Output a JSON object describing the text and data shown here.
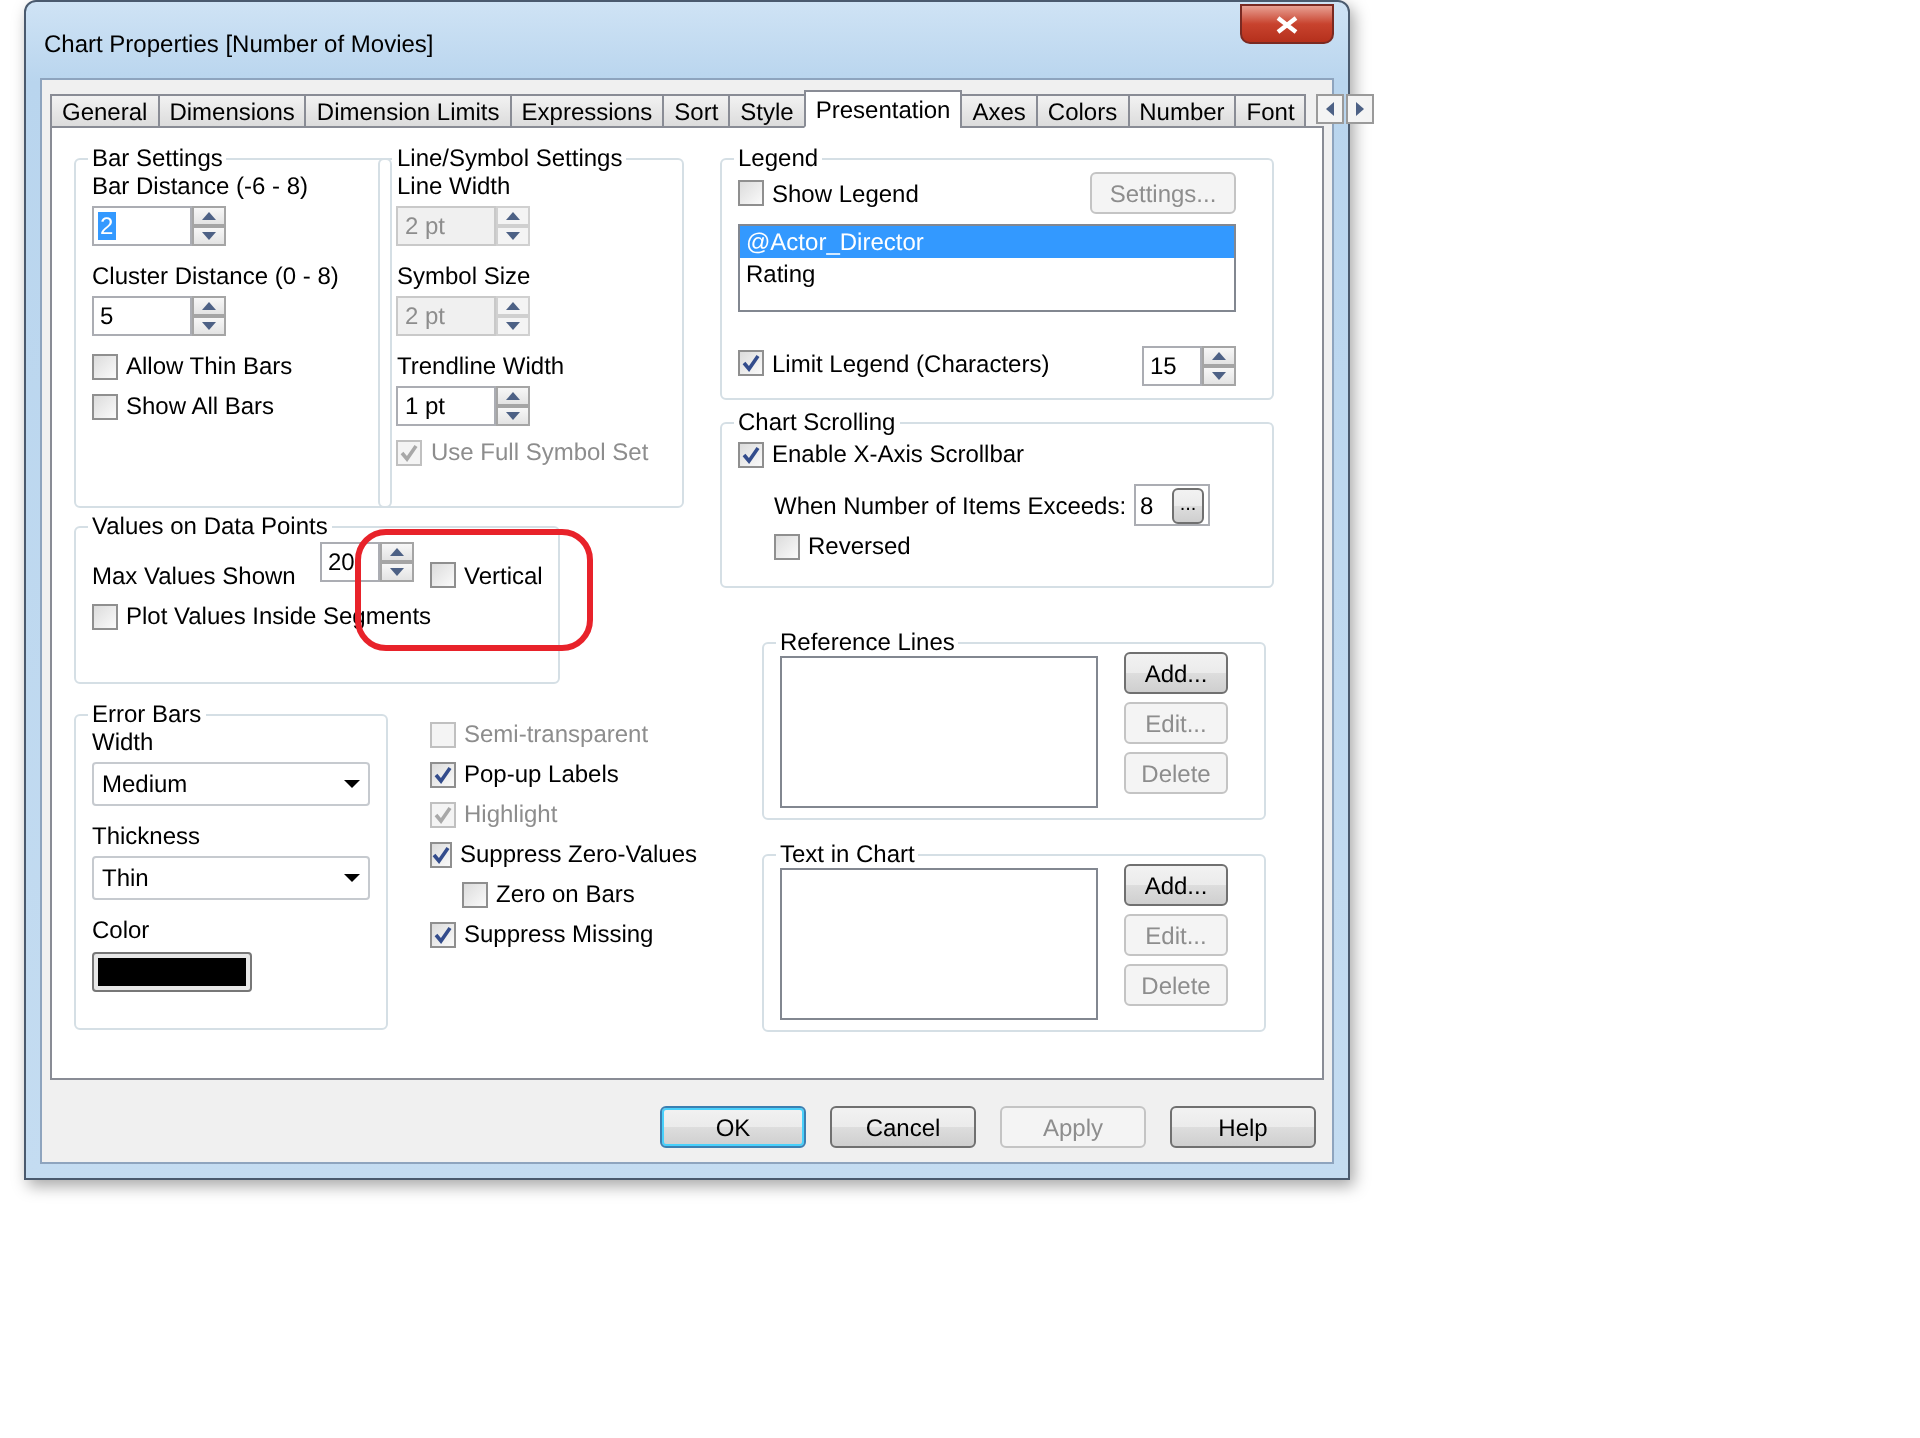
{
  "window": {
    "title": "Chart Properties [Number of Movies]"
  },
  "tabs": [
    {
      "label": "General",
      "selected": false
    },
    {
      "label": "Dimensions",
      "selected": false
    },
    {
      "label": "Dimension Limits",
      "selected": false
    },
    {
      "label": "Expressions",
      "selected": false
    },
    {
      "label": "Sort",
      "selected": false
    },
    {
      "label": "Style",
      "selected": false
    },
    {
      "label": "Presentation",
      "selected": true
    },
    {
      "label": "Axes",
      "selected": false
    },
    {
      "label": "Colors",
      "selected": false
    },
    {
      "label": "Number",
      "selected": false
    },
    {
      "label": "Font",
      "selected": false
    }
  ],
  "bar_settings": {
    "title": "Bar Settings",
    "fields": [
      {
        "label": "Bar Distance (-6 - 8)",
        "value": "2",
        "selected": true
      },
      {
        "label": "Cluster Distance (0 - 8)",
        "value": "5",
        "selected": false
      }
    ],
    "checkboxes": [
      {
        "label": "Allow Thin Bars",
        "checked": false
      },
      {
        "label": "Show All Bars",
        "checked": false
      }
    ]
  },
  "line_symbol_settings": {
    "title": "Line/Symbol Settings",
    "fields": [
      {
        "label": "Line Width",
        "value": "2 pt",
        "disabled": true
      },
      {
        "label": "Symbol Size",
        "value": "2 pt",
        "disabled": true
      },
      {
        "label": "Trendline Width",
        "value": "1 pt",
        "disabled": false
      }
    ],
    "checkbox": {
      "label": "Use Full Symbol Set",
      "checked": true,
      "disabled": true
    }
  },
  "values_on_data_points": {
    "title": "Values on Data Points",
    "max_values": {
      "label": "Max Values Shown",
      "value": "20"
    },
    "vertical": {
      "label": "Vertical",
      "checked": false
    },
    "plot_inside": {
      "label": "Plot Values Inside Segments",
      "checked": false
    }
  },
  "error_bars": {
    "title": "Error Bars",
    "dropdowns": [
      {
        "label": "Width",
        "value": "Medium"
      },
      {
        "label": "Thickness",
        "value": "Thin"
      }
    ],
    "color": {
      "label": "Color",
      "color": "#000000"
    }
  },
  "options": [
    {
      "label": "Semi-transparent",
      "checked": false,
      "disabled": true
    },
    {
      "label": "Pop-up Labels",
      "checked": true,
      "disabled": false
    },
    {
      "label": "Highlight",
      "checked": true,
      "disabled": true
    },
    {
      "label": "Suppress Zero-Values",
      "checked": true,
      "disabled": false,
      "children": [
        {
          "label": "Zero on Bars",
          "checked": false,
          "disabled": false
        }
      ]
    },
    {
      "label": "Suppress Missing",
      "checked": true,
      "disabled": false
    }
  ],
  "legend": {
    "title": "Legend",
    "show_legend": {
      "label": "Show Legend",
      "checked": false
    },
    "settings_button": {
      "label": "Settings...",
      "disabled": true
    },
    "items": [
      {
        "label": "@Actor_Director",
        "selected": true
      },
      {
        "label": "Rating",
        "selected": false
      }
    ],
    "limit": {
      "label": "Limit Legend (Characters)",
      "checked": true,
      "value": "15"
    }
  },
  "chart_scrolling": {
    "title": "Chart Scrolling",
    "enable": {
      "label": "Enable X-Axis Scrollbar",
      "checked": true
    },
    "threshold": {
      "label": "When Number of Items Exceeds:",
      "value": "8",
      "button": "..."
    },
    "reversed": {
      "label": "Reversed",
      "checked": false
    }
  },
  "reference_lines": {
    "title": "Reference Lines",
    "buttons": [
      {
        "label": "Add...",
        "disabled": false
      },
      {
        "label": "Edit...",
        "disabled": true
      },
      {
        "label": "Delete",
        "disabled": true
      }
    ]
  },
  "text_in_chart": {
    "title": "Text in Chart",
    "buttons": [
      {
        "label": "Add...",
        "disabled": false
      },
      {
        "label": "Edit...",
        "disabled": true
      },
      {
        "label": "Delete",
        "disabled": true
      }
    ]
  },
  "buttons": [
    {
      "label": "OK",
      "default": true,
      "disabled": false
    },
    {
      "label": "Cancel",
      "default": false,
      "disabled": false
    },
    {
      "label": "Apply",
      "default": false,
      "disabled": true
    },
    {
      "label": "Help",
      "default": false,
      "disabled": false
    }
  ]
}
